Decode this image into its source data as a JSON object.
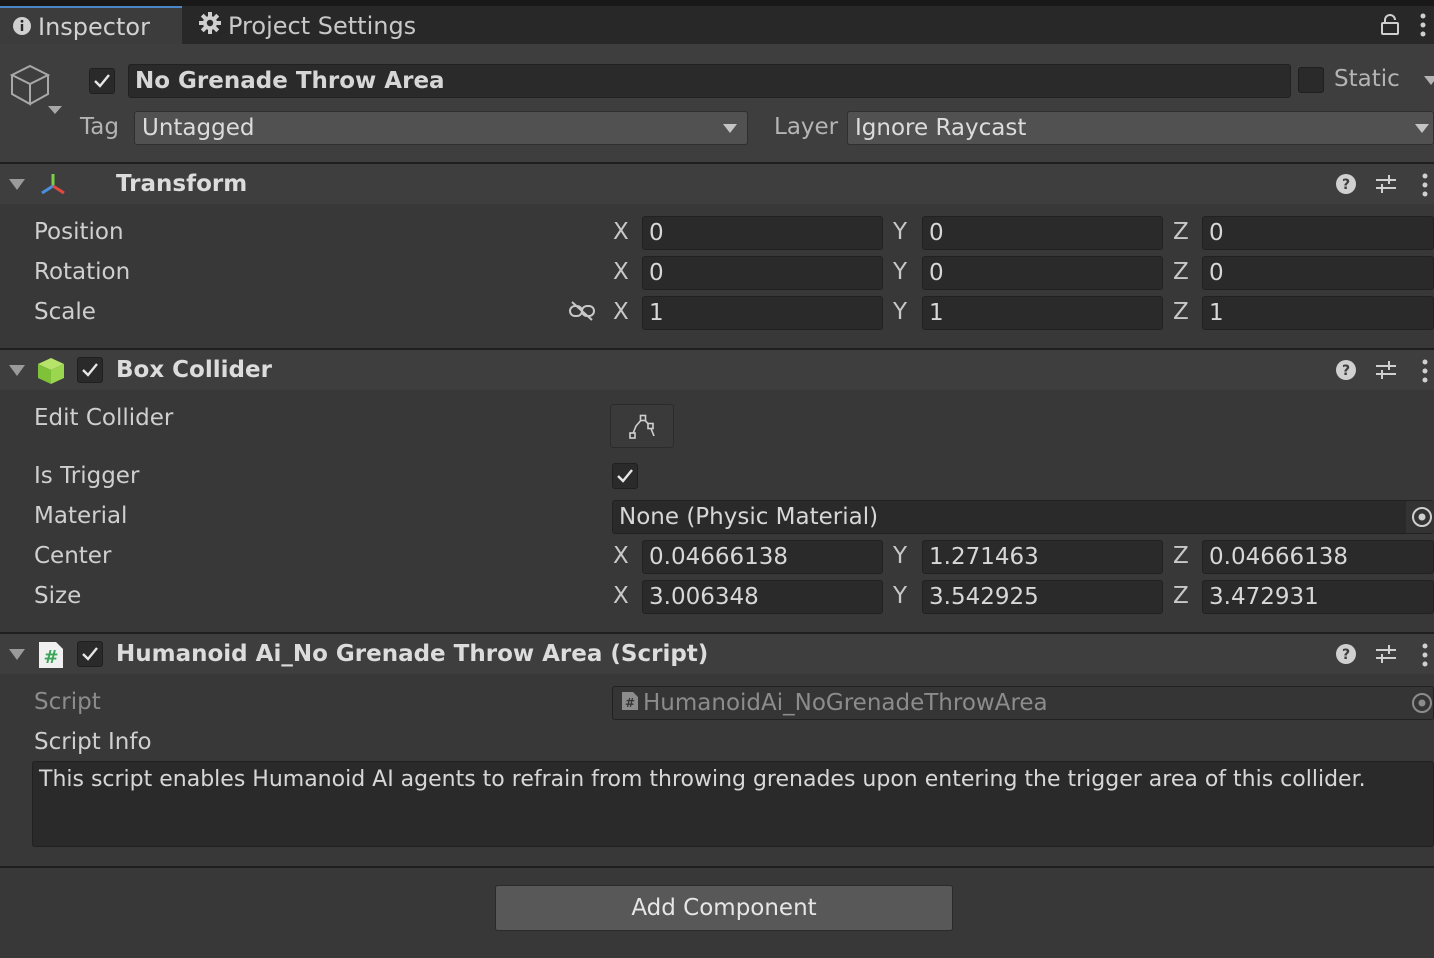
{
  "tabs": [
    {
      "label": "Inspector",
      "icon": "info-icon"
    },
    {
      "label": "Project Settings",
      "icon": "gear-icon"
    }
  ],
  "gameobject": {
    "active": true,
    "name": "No Grenade Throw Area",
    "static_label": "Static",
    "static": false,
    "tag_label": "Tag",
    "tag_value": "Untagged",
    "layer_label": "Layer",
    "layer_value": "Ignore Raycast"
  },
  "transform": {
    "title": "Transform",
    "rows": [
      {
        "label": "Position",
        "x": "0",
        "y": "0",
        "z": "0"
      },
      {
        "label": "Rotation",
        "x": "0",
        "y": "0",
        "z": "0"
      },
      {
        "label": "Scale",
        "x": "1",
        "y": "1",
        "z": "1"
      }
    ]
  },
  "box_collider": {
    "title": "Box Collider",
    "enabled": true,
    "edit_collider_label": "Edit Collider",
    "is_trigger_label": "Is Trigger",
    "is_trigger": true,
    "material_label": "Material",
    "material_value": "None (Physic Material)",
    "center_label": "Center",
    "center": {
      "x": "0.04666138",
      "y": "1.271463",
      "z": "0.04666138"
    },
    "size_label": "Size",
    "size": {
      "x": "3.006348",
      "y": "3.542925",
      "z": "3.472931"
    }
  },
  "script_component": {
    "title": "Humanoid Ai_No Grenade Throw Area (Script)",
    "enabled": true,
    "script_label": "Script",
    "script_value": "HumanoidAi_NoGrenadeThrowArea",
    "info_label": "Script Info",
    "info_text": "This script enables Humanoid AI agents to refrain from throwing grenades upon entering the trigger area of this collider."
  },
  "axes": {
    "x": "X",
    "y": "Y",
    "z": "Z"
  },
  "add_component_label": "Add Component"
}
